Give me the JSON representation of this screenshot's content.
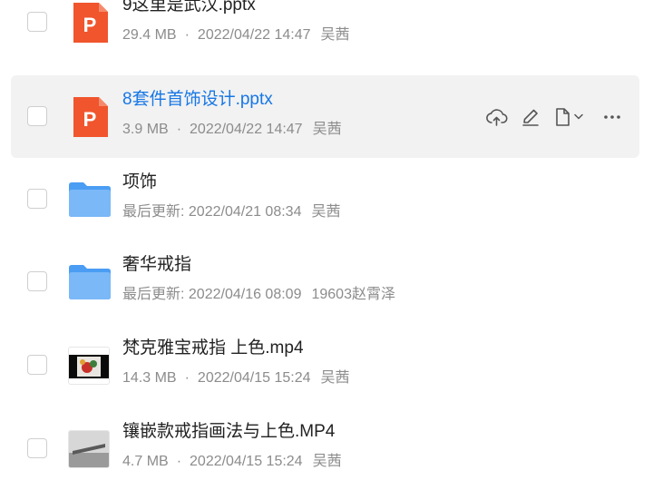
{
  "files": [
    {
      "type": "pptx",
      "name": "9这里是武汉.pptx",
      "size": "29.4 MB",
      "separator": "·",
      "date": "2022/04/22 14:47",
      "owner": "吴茜"
    },
    {
      "type": "pptx",
      "name": "8套件首饰设计.pptx",
      "size": "3.9 MB",
      "separator": "·",
      "date": "2022/04/22 14:47",
      "owner": "吴茜",
      "state": "hovered"
    },
    {
      "type": "folder",
      "name": "项饰",
      "size": "最后更新:",
      "separator": "",
      "date": "2022/04/21 08:34",
      "owner": "吴茜"
    },
    {
      "type": "folder",
      "name": "奢华戒指",
      "size": "最后更新:",
      "separator": "",
      "date": "2022/04/16 08:09",
      "owner": "19603赵霄泽"
    },
    {
      "type": "video",
      "name": "梵克雅宝戒指 上色.mp4",
      "size": "14.3 MB",
      "separator": "·",
      "date": "2022/04/15 15:24",
      "owner": "吴茜"
    },
    {
      "type": "video",
      "name": "镶嵌款戒指画法与上色.MP4",
      "size": "4.7 MB",
      "separator": "·",
      "date": "2022/04/15 15:24",
      "owner": "吴茜"
    }
  ],
  "hover_actions": [
    "cloud-upload-icon",
    "edit-icon",
    "file-menu-icon",
    "chevron-down-icon",
    "more-icon"
  ],
  "colors": {
    "pptx_icon": "#f0552d",
    "folder_icon": "#4a9df3",
    "active_name": "#1677e6",
    "hover_row_bg": "#f2f2f2",
    "meta_text": "#8c8c8c"
  }
}
